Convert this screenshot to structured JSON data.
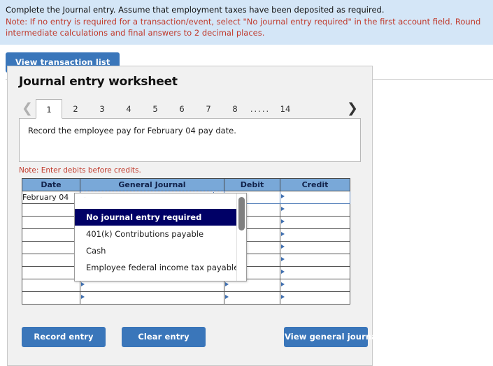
{
  "instructions": {
    "line1": "Complete the Journal entry. Assume that employment taxes have been deposited as required.",
    "note": "Note: If no entry is required for a transaction/event, select \"No journal entry required\" in the first account field. Round intermediate calculations and final answers to 2 decimal places."
  },
  "toolbar": {
    "view_transaction_list": "View transaction list"
  },
  "worksheet": {
    "title": "Journal entry worksheet",
    "pager": {
      "prev_icon": "chevron-left-icon",
      "next_icon": "chevron-right-icon",
      "tabs": [
        "1",
        "2",
        "3",
        "4",
        "5",
        "6",
        "7",
        "8",
        ".....",
        "14"
      ],
      "active_tab": "1"
    },
    "prompt": "Record the employee pay for February 04 pay date.",
    "note_debits": "Note: Enter debits before credits."
  },
  "table": {
    "headers": [
      "Date",
      "General Journal",
      "Debit",
      "Credit"
    ],
    "rows": [
      {
        "date": "February 04",
        "general_journal": "",
        "debit": "",
        "credit": ""
      },
      {
        "date": "",
        "general_journal": "",
        "debit": "",
        "credit": ""
      },
      {
        "date": "",
        "general_journal": "",
        "debit": "",
        "credit": ""
      },
      {
        "date": "",
        "general_journal": "",
        "debit": "",
        "credit": ""
      },
      {
        "date": "",
        "general_journal": "",
        "debit": "",
        "credit": ""
      },
      {
        "date": "",
        "general_journal": "",
        "debit": "",
        "credit": ""
      },
      {
        "date": "",
        "general_journal": "",
        "debit": "",
        "credit": ""
      },
      {
        "date": "",
        "general_journal": "",
        "debit": "",
        "credit": ""
      },
      {
        "date": "",
        "general_journal": "",
        "debit": "",
        "credit": ""
      }
    ]
  },
  "dropdown": {
    "open": true,
    "selected": "No journal entry required",
    "options": [
      "No journal entry required",
      "401(k) Contributions payable",
      "Cash",
      "Employee federal income tax payable"
    ]
  },
  "actions": {
    "record_entry": "Record entry",
    "clear_entry": "Clear entry",
    "view_general_journal": "View general journal"
  },
  "colors": {
    "band_bg": "#d4e6f7",
    "note_red": "#c0392b",
    "button_blue": "#3a76ba",
    "table_header_blue": "#79a8d8",
    "dropdown_selected": "#000066"
  }
}
